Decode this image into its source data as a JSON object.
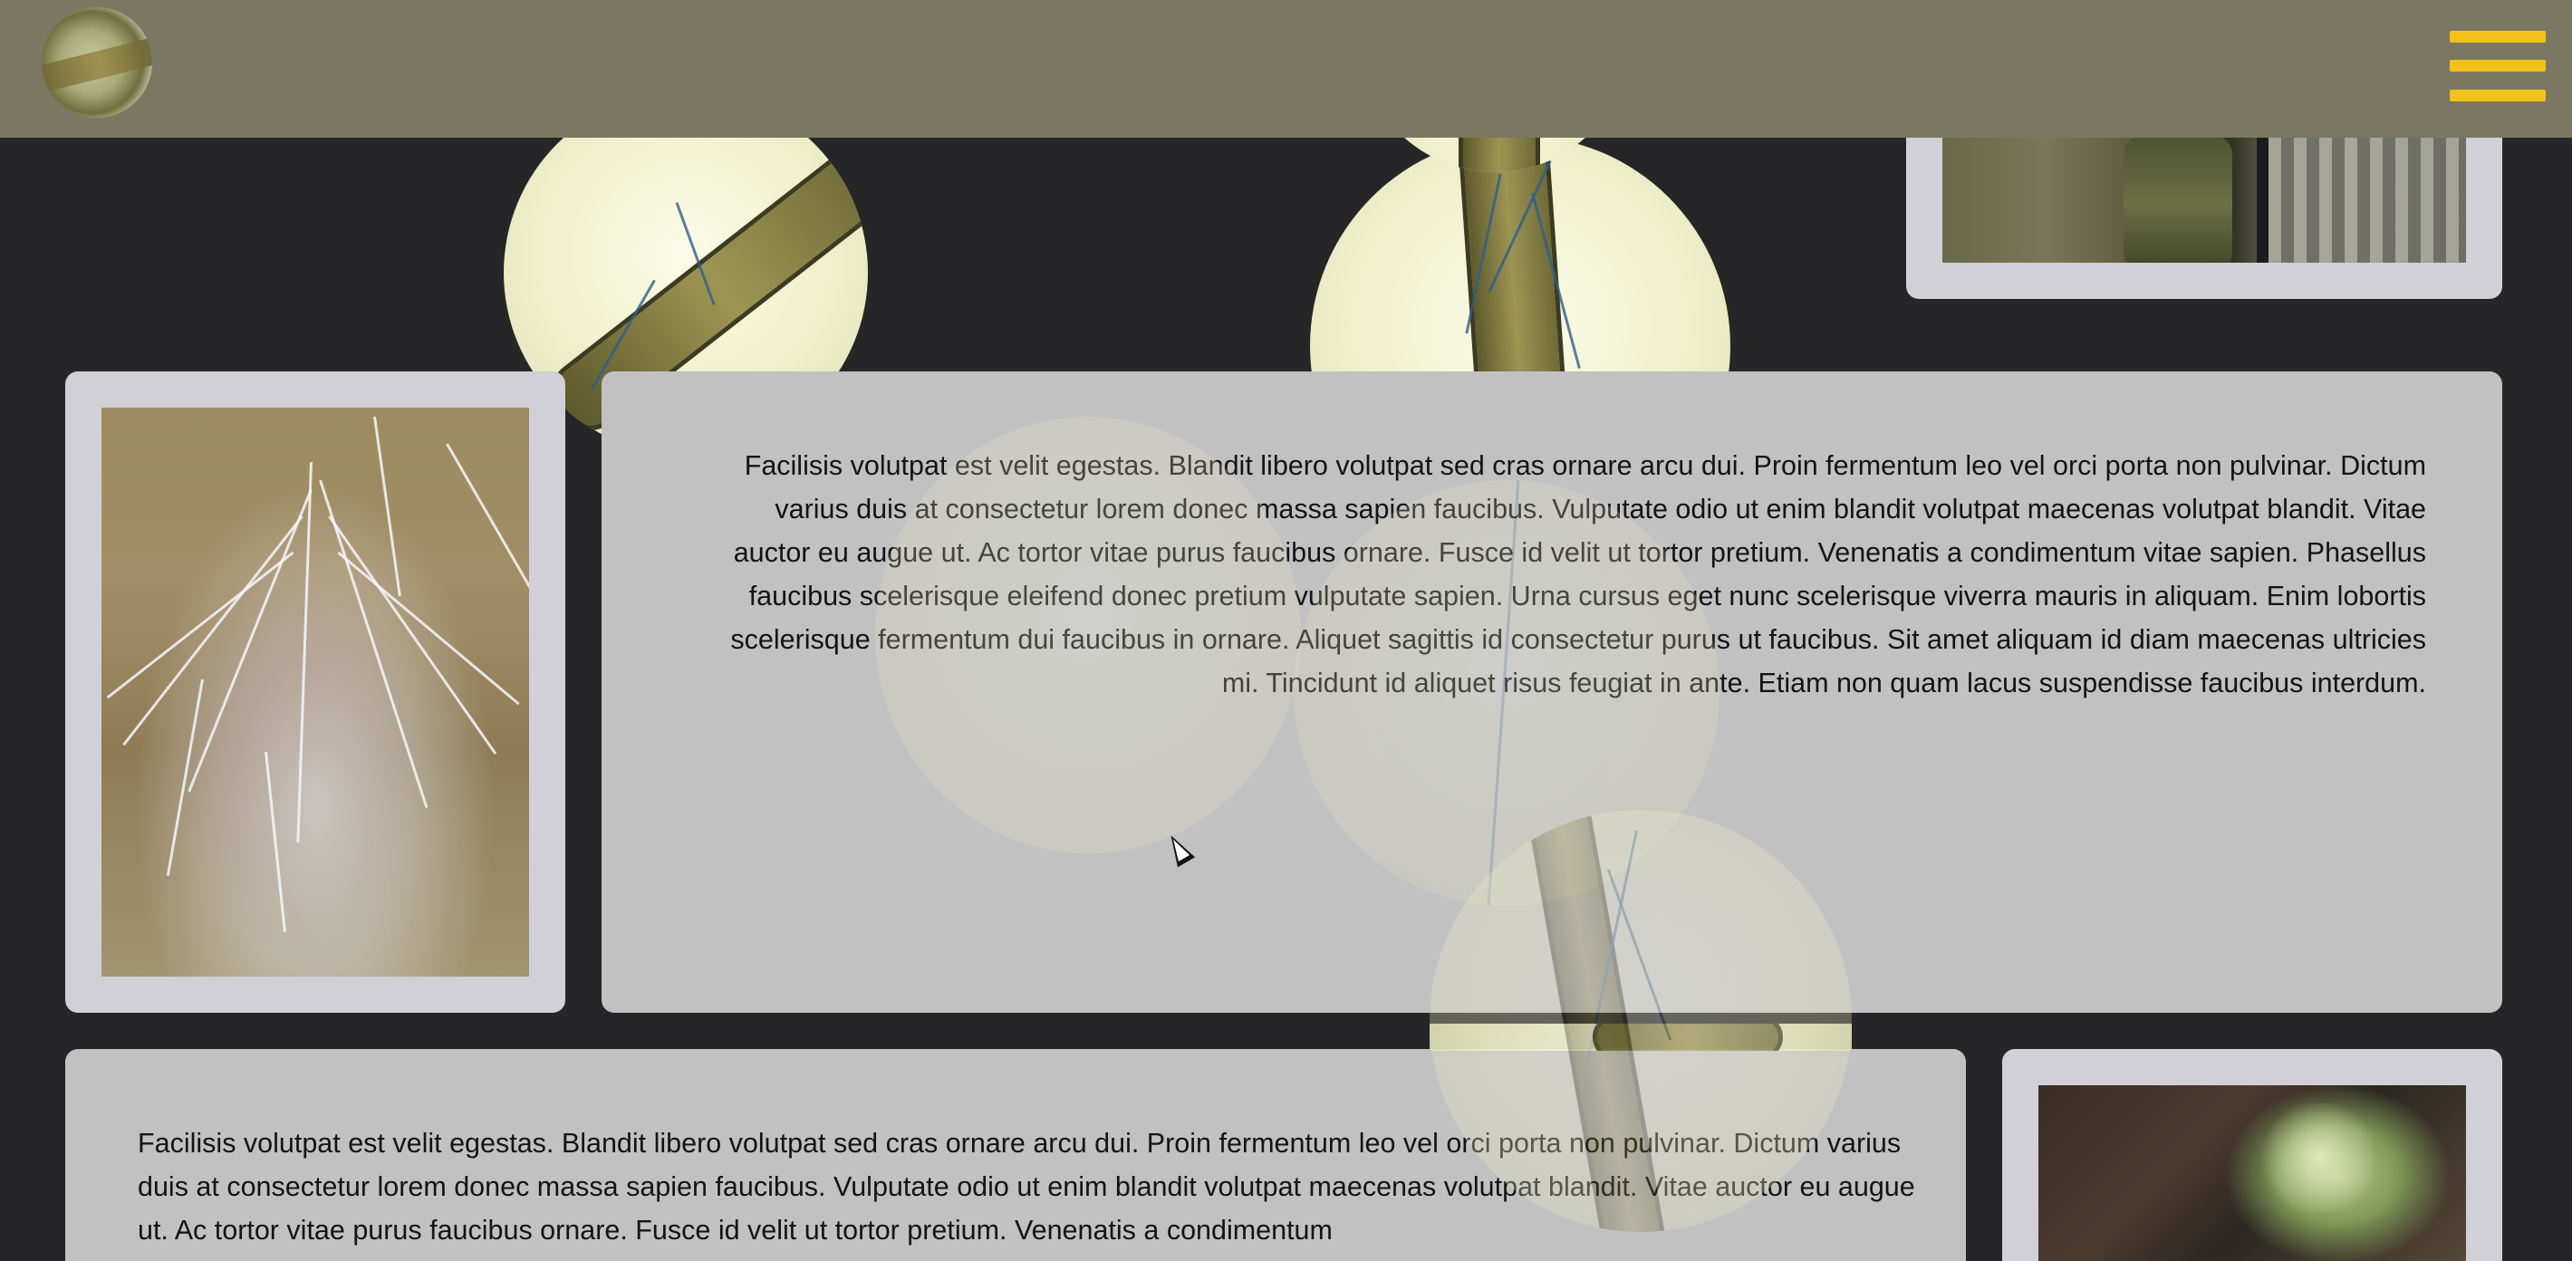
{
  "header": {
    "logo_alt": "microscope root logo",
    "menu_icon": "hamburger-menu-icon",
    "menu_color": "#f2c21a",
    "background": "#7a7862"
  },
  "cards": {
    "mycelium_photo": {
      "alt": "white mycelium strands on brown surface"
    },
    "top_right_photo": {
      "alt": "person in plaid shirt beside mossy tree trunk"
    },
    "bottom_right_photo": {
      "alt": "green plant sprigs on dark forest floor"
    },
    "text_card_1": {
      "text": "Facilisis volutpat est velit egestas. Blandit libero volutpat sed cras ornare arcu dui. Proin fermentum leo vel orci porta non pulvinar. Dictum varius duis at consectetur lorem donec massa sapien faucibus. Vulputate odio ut enim blandit volutpat maecenas volutpat blandit. Vitae auctor eu augue ut. Ac tortor vitae purus faucibus ornare. Fusce id velit ut tortor pretium. Venenatis a condimentum vitae sapien. Phasellus faucibus scelerisque eleifend donec pretium vulputate sapien. Urna cursus eget nunc scelerisque viverra mauris in aliquam. Enim lobortis scelerisque fermentum dui faucibus in ornare. Aliquet sagittis id consectetur purus ut faucibus. Sit amet aliquam id diam maecenas ultricies mi. Tincidunt id aliquet risus feugiat in ante. Etiam non quam lacus suspendisse faucibus interdum."
    },
    "text_card_2": {
      "text": "Facilisis volutpat est velit egestas. Blandit libero volutpat sed cras ornare arcu dui. Proin fermentum leo vel orci porta non pulvinar. Dictum varius duis at consectetur lorem donec massa sapien faucibus. Vulputate odio ut enim blandit volutpat maecenas volutpat blandit. Vitae auctor eu augue ut. Ac tortor vitae purus faucibus ornare. Fusce id velit ut tortor pretium. Venenatis a condimentum"
    }
  },
  "colors": {
    "page_background": "#262628",
    "photo_card": "#d1d0d6",
    "text_card": "#c1c1c2"
  }
}
